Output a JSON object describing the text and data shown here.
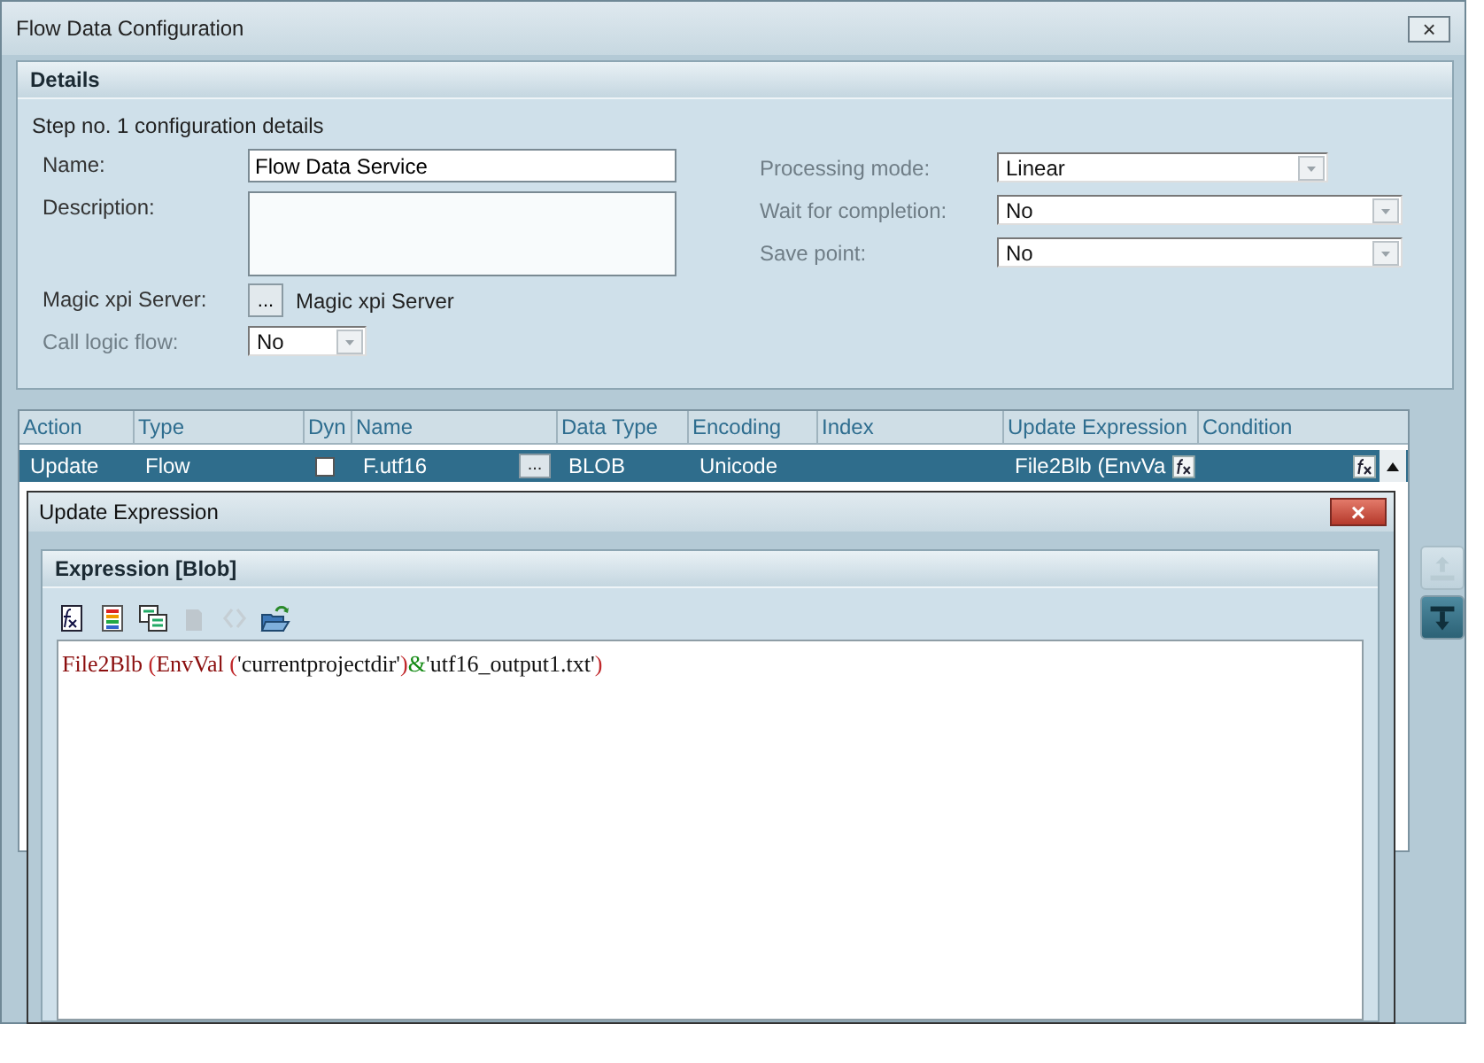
{
  "window": {
    "title": "Flow Data Configuration",
    "close": "×"
  },
  "details": {
    "title": "Details",
    "subtitle": "Step no. 1 configuration details",
    "left_fields": [
      {
        "kind": "text",
        "label": "Name:",
        "value": "Flow Data Service",
        "disabled": false
      },
      {
        "kind": "textarea",
        "label": "Description:",
        "disabled": false
      },
      {
        "kind": "picker",
        "label": "Magic xpi Server:",
        "button": "...",
        "value": "Magic xpi Server",
        "disabled": false
      },
      {
        "kind": "combo",
        "label": "Call logic flow:",
        "value": "No",
        "disabled": true
      }
    ],
    "right_fields": [
      {
        "kind": "combo",
        "label": "Processing mode:",
        "value": "Linear",
        "disabled": true
      },
      {
        "kind": "combo",
        "label": "Wait for completion:",
        "value": "No",
        "disabled": true
      },
      {
        "kind": "combo",
        "label": "Save point:",
        "value": "No",
        "disabled": true
      }
    ]
  },
  "table": {
    "columns": [
      "Action",
      "Type",
      "Dyn",
      "Name",
      "Data Type",
      "Encoding",
      "Index",
      "Update Expression",
      "Condition"
    ],
    "rows": [
      {
        "selected": true,
        "action": "Update",
        "type": "Flow",
        "dyn": false,
        "name": "F.utf16",
        "name_button": "...",
        "data_type": "BLOB",
        "encoding": "Unicode",
        "update_expression": "File2Blb (EnvVa"
      }
    ]
  },
  "side_buttons": [
    {
      "kind": "up",
      "disabled": true
    },
    {
      "kind": "down",
      "disabled": false
    }
  ],
  "dialog": {
    "title": "Update Expression",
    "close": "×",
    "panel_title": "Expression [Blob]",
    "toolbar": [
      {
        "kind": "function",
        "disabled": false
      },
      {
        "kind": "list",
        "disabled": false
      },
      {
        "kind": "variables",
        "disabled": false
      },
      {
        "kind": "blank",
        "disabled": true
      },
      {
        "kind": "brackets",
        "disabled": true
      },
      {
        "kind": "open",
        "disabled": false
      }
    ],
    "expression": [
      {
        "kind": "function",
        "text": "File2Blb"
      },
      {
        "kind": "paren",
        "text": " ("
      },
      {
        "kind": "function",
        "text": "EnvVal"
      },
      {
        "kind": "paren",
        "text": " ("
      },
      {
        "kind": "string",
        "text": "'currentprojectdir'"
      },
      {
        "kind": "paren",
        "text": ")"
      },
      {
        "kind": "operator",
        "text": "&"
      },
      {
        "kind": "string",
        "text": "'utf16_output1.txt'"
      },
      {
        "kind": "paren",
        "text": ")"
      }
    ]
  }
}
